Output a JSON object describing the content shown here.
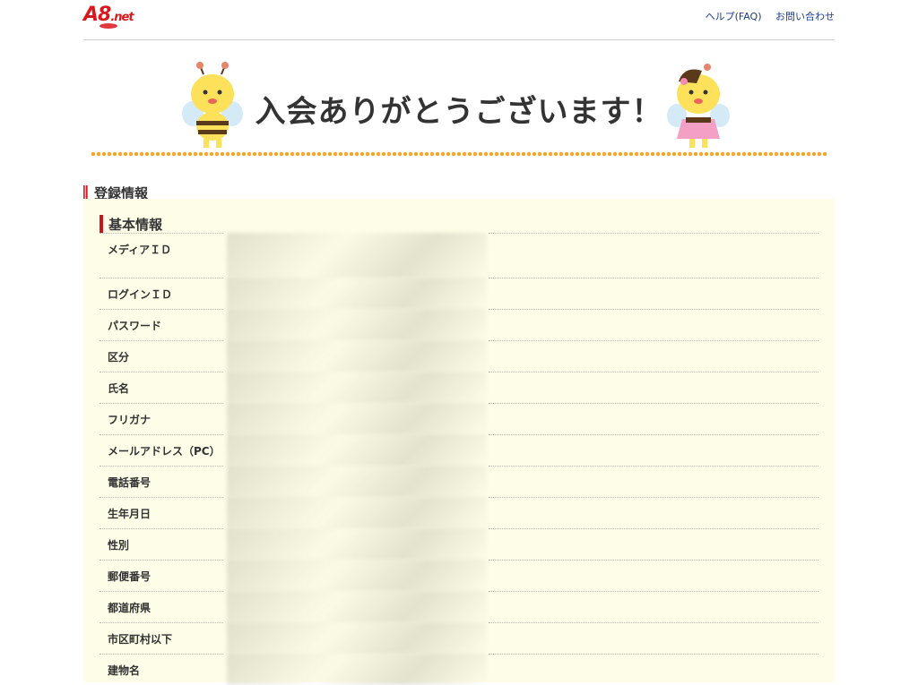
{
  "header": {
    "logo_text": "A8",
    "logo_suffix": ".net",
    "links": [
      "ヘルプ(FAQ)",
      "お問い合わせ"
    ]
  },
  "banner": {
    "welcome": "入会ありがとうございます！"
  },
  "section": {
    "title": "登録情報"
  },
  "panel": {
    "subtitle": "基本情報",
    "rows": [
      {
        "label": "メディアＩＤ"
      },
      {
        "label": "ログインＩＤ"
      },
      {
        "label": "パスワード"
      },
      {
        "label": "区分"
      },
      {
        "label": "氏名"
      },
      {
        "label": "フリガナ"
      },
      {
        "label": "メールアドレス（PC）"
      },
      {
        "label": "電話番号"
      },
      {
        "label": "生年月日"
      },
      {
        "label": "性別"
      },
      {
        "label": "郵便番号"
      },
      {
        "label": "都道府県"
      },
      {
        "label": "市区町村以下"
      },
      {
        "label": "建物名"
      }
    ]
  },
  "colors": {
    "brand_red": "#d7191f",
    "link_blue": "#1a3b8c",
    "panel_bg": "#fefee8",
    "dot_orange": "#f6a52b"
  }
}
